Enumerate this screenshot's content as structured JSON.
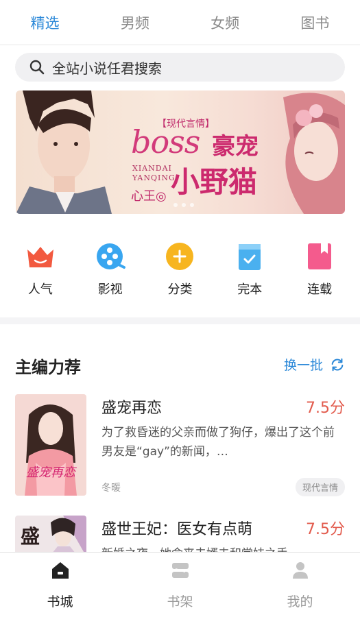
{
  "top_tabs": [
    {
      "label": "精选",
      "active": true
    },
    {
      "label": "男频",
      "active": false
    },
    {
      "label": "女频",
      "active": false
    },
    {
      "label": "图书",
      "active": false
    }
  ],
  "search": {
    "placeholder": "全站小说任君搜索",
    "icon": "search-icon"
  },
  "banner": {
    "tag": "【现代言情】",
    "title_latin": "boss",
    "title_part1": "豪宠",
    "title_part2": "小野猫",
    "pinyin": "XIANDAI\nYANQING",
    "author": "心王◎"
  },
  "categories": [
    {
      "label": "人气",
      "icon": "crown-icon",
      "color": "#f2593f"
    },
    {
      "label": "影视",
      "icon": "film-reel-icon",
      "color": "#39a6f0"
    },
    {
      "label": "分类",
      "icon": "plus-circle-icon",
      "color": "#f7b51f"
    },
    {
      "label": "完本",
      "icon": "check-folder-icon",
      "color": "#4ab0ef"
    },
    {
      "label": "连载",
      "icon": "bookmark-icon",
      "color": "#f45b8d"
    }
  ],
  "section": {
    "title": "主编力荐",
    "refresh_label": "换一批",
    "refresh_icon": "refresh-icon"
  },
  "books": [
    {
      "title": "盛宠再恋",
      "score": "7.5分",
      "description": "为了救昏迷的父亲而做了狗仔，爆出了这个前男友是“gay”的新闻，…",
      "author": "冬暖",
      "tag": "现代言情",
      "cover_text": "盛宠再恋"
    },
    {
      "title": "盛世王妃：医女有点萌",
      "score": "7.5分",
      "description": "新婚之夜，她命丧夫婿未和堂妹之手",
      "cover_text": "盛"
    }
  ],
  "bottom_nav": [
    {
      "label": "书城",
      "icon": "home-icon",
      "active": true
    },
    {
      "label": "书架",
      "icon": "bookshelf-icon",
      "active": false
    },
    {
      "label": "我的",
      "icon": "user-icon",
      "active": false
    }
  ],
  "colors": {
    "accent": "#2b88d8",
    "score": "#e25b4d"
  }
}
